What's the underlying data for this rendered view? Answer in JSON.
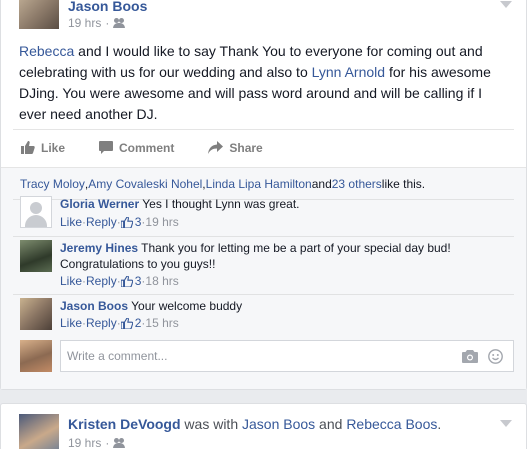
{
  "post": {
    "author": "Jason Boos",
    "time": "19 hrs",
    "privacy_icon": "friends-icon",
    "text_parts": {
      "mention1": "Rebecca",
      "t1": " and I would like to say Thank You to everyone for coming out and celebrating with us for our wedding and also to ",
      "mention2": "Lynn Arnold",
      "t2": " for his awesome DJing. You were awesome and will pass word around and will be calling if I ever need another DJ."
    },
    "actions": {
      "like": "Like",
      "comment": "Comment",
      "share": "Share"
    }
  },
  "likes_summary": {
    "names": [
      "Tracy Moloy",
      "Amy Covaleski Nohel",
      "Linda Lipa Hamilton"
    ],
    "sep1": ", ",
    "and": " and ",
    "others": "23 others",
    "suffix": " like this."
  },
  "comments": [
    {
      "name": "Gloria Werner",
      "text": "Yes I thought Lynn was great.",
      "like_label": "Like",
      "reply_label": "Reply",
      "likes": "3",
      "time": "19 hrs"
    },
    {
      "name": "Jeremy Hines",
      "text": "Thank you for letting me be a part of your special day bud! Congratulations to you guys!!",
      "like_label": "Like",
      "reply_label": "Reply",
      "likes": "3",
      "time": "18 hrs"
    },
    {
      "name": "Jason Boos",
      "text": "Your welcome buddy",
      "like_label": "Like",
      "reply_label": "Reply",
      "likes": "2",
      "time": "15 hrs"
    }
  ],
  "meta_sep": " · ",
  "write_comment": {
    "placeholder": "Write a comment..."
  },
  "post2": {
    "author": "Kristen DeVoogd",
    "with_text": " was with ",
    "tag1": "Jason Boos",
    "and_text": " and ",
    "tag2": "Rebecca Boos",
    "period": ".",
    "time": "19 hrs"
  },
  "colors": {
    "link": "#365899",
    "meta": "#90949c",
    "background": "#e9ebee"
  }
}
